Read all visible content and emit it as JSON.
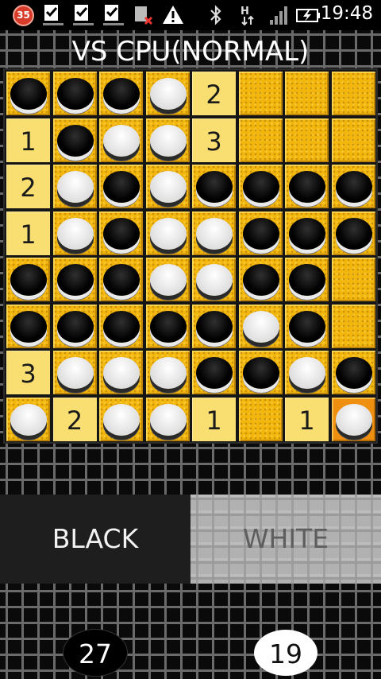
{
  "status_bar": {
    "notification_count": "35",
    "time": "19:48",
    "icons": [
      "task-done-icon",
      "task-done-icon",
      "task-done-icon",
      "sd-card-error-icon",
      "warning-icon",
      "bluetooth-icon",
      "hspa-data-icon",
      "signal-icon",
      "battery-charging-icon"
    ]
  },
  "title": "VS CPU(NORMAL)",
  "board": {
    "size": 8,
    "rows": [
      [
        "B",
        "B",
        "B",
        "W",
        "2",
        "",
        "",
        ""
      ],
      [
        "1",
        "B",
        "W",
        "W",
        "3",
        "",
        "",
        ""
      ],
      [
        "2",
        "W",
        "B",
        "W",
        "B",
        "B",
        "B",
        "B"
      ],
      [
        "1",
        "W",
        "B",
        "W",
        "W",
        "B",
        "B",
        "B"
      ],
      [
        "B",
        "B",
        "B",
        "W",
        "W",
        "B",
        "B",
        ""
      ],
      [
        "B",
        "B",
        "B",
        "B",
        "B",
        "W",
        "B",
        ""
      ],
      [
        "3",
        "W",
        "W",
        "W",
        "B",
        "B",
        "W",
        "B"
      ],
      [
        "W",
        "2",
        "W",
        "W",
        "1",
        "",
        "1",
        "W"
      ]
    ],
    "last_move": {
      "row": 7,
      "col": 7
    },
    "colors": {
      "board": "#f2b60c",
      "hint": "#f9df72",
      "last_move": "#ef8f10"
    }
  },
  "turn": {
    "black_label": "BLACK",
    "white_label": "WHITE",
    "active": "black"
  },
  "score": {
    "black": "27",
    "white": "19"
  }
}
